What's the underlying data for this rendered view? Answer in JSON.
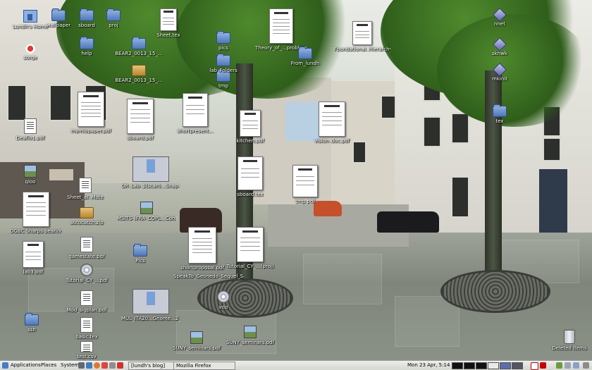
{
  "desktop": {
    "icons": [
      {
        "label": "Lundh's Home",
        "icon": "home-icon"
      },
      {
        "label": "wallpaper",
        "icon": "folder-icon"
      },
      {
        "label": "sboard",
        "icon": "folder-icon"
      },
      {
        "label": "proj",
        "icon": "folder-icon"
      },
      {
        "label": "help",
        "icon": "folder-icon"
      },
      {
        "label": "sorge",
        "icon": "document-icon"
      },
      {
        "label": "Sheet.tex",
        "icon": "text-file-icon"
      },
      {
        "label": "BEAR2_0013_15_...",
        "icon": "folder-icon"
      },
      {
        "label": "BEAR2_0013_15_...",
        "icon": "package-icon"
      },
      {
        "label": "mymiopaper.pdf",
        "icon": "pdf-icon"
      },
      {
        "label": "sboard.pdf",
        "icon": "pdf-icon"
      },
      {
        "label": "shortpresent...",
        "icon": "pdf-icon"
      },
      {
        "label": "pics",
        "icon": "folder-icon"
      },
      {
        "label": "Theory_of_...probleme.pdf",
        "icon": "pdf-icon"
      },
      {
        "label": "From_lundh",
        "icon": "folder-icon"
      },
      {
        "label": "Foundational_Hierarchy_Enhanced_Timestamps_Net_Shell_top_Shop",
        "icon": "pdf-icon"
      },
      {
        "label": "tmp",
        "icon": "folder-icon"
      },
      {
        "label": "lab_Folders",
        "icon": "folder-icon"
      },
      {
        "label": "kitchen.pdf",
        "icon": "pdf-icon"
      },
      {
        "label": "vision_doc.pdf",
        "icon": "pdf-icon"
      },
      {
        "label": "tmp.pdf",
        "icon": "pdf-icon"
      },
      {
        "label": "sboard.tex",
        "icon": "text-file-icon"
      },
      {
        "label": "Deaflo1.pdf",
        "icon": "text-file-icon"
      },
      {
        "label": "qloo",
        "icon": "image-icon"
      },
      {
        "label": "Sheet_at_Mote",
        "icon": "text-file-icon"
      },
      {
        "label": "OR_Lab_1(scan)...Snap_Sharp_fancy",
        "icon": "screenshot-icon"
      },
      {
        "label": "OGBC Sharps bearing",
        "icon": "pdf-icon"
      },
      {
        "label": "autocatch.zip",
        "icon": "package-icon"
      },
      {
        "label": "MSITS_iFRA_COPL...Controlled_Gable...hunk.pdf",
        "icon": "image-icon"
      },
      {
        "label": "Pics",
        "icon": "folder-icon"
      },
      {
        "label": "shortproposal.pdf",
        "icon": "pdf-icon"
      },
      {
        "label": "Tutorial_CY_...(proj)",
        "icon": "pdf-icon"
      },
      {
        "label": "SpeakTo_Geonedo_Sequel_Saliency_Shortcuts",
        "icon": "pdf-icon"
      },
      {
        "label": "lab3.pdf",
        "icon": "pdf-icon"
      },
      {
        "label": "gamestate.pdf",
        "icon": "text-file-icon"
      },
      {
        "label": "Tutorial_CY_...pdf",
        "icon": "pdf-icon"
      },
      {
        "label": "Mod_sigplan.pdf",
        "icon": "text-file-icon"
      },
      {
        "label": "ssh",
        "icon": "folder-icon"
      },
      {
        "label": "basic.tex",
        "icon": "text-file-icon"
      },
      {
        "label": "test.csv",
        "icon": "text-file-icon"
      },
      {
        "label": "MUL_ITA20...Gnome...2_flat",
        "icon": "screenshot-icon"
      },
      {
        "label": "SUNY_seminars.pdf",
        "icon": "image-icon"
      },
      {
        "label": "SUNY_seminars.pdf",
        "icon": "image-icon"
      },
      {
        "label": "vdp",
        "icon": "disc-icon"
      },
      {
        "label": "nnet",
        "icon": "disk-icon"
      },
      {
        "label": "sknwk",
        "icon": "disk-icon"
      },
      {
        "label": "mkinit",
        "icon": "disk-icon"
      },
      {
        "label": "tex",
        "icon": "folder-icon"
      },
      {
        "label": "Deleted Items",
        "icon": "trash-icon"
      }
    ]
  },
  "panel": {
    "menu_applications": "Applications",
    "menu_places": "Places",
    "menu_system": "System",
    "task_blog": "[lundh's blog]",
    "task_firefox": "Mozilla Firefox",
    "clock": "Mon 23 Apr,  5:14 PM"
  }
}
